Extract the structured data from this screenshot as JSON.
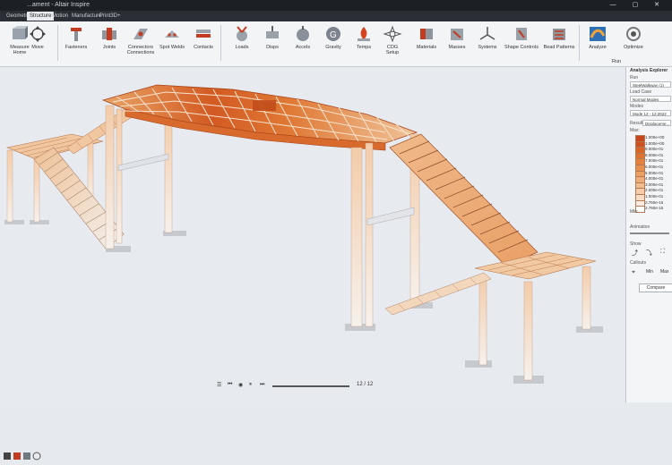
{
  "window": {
    "title": "...ament - Altair Inspire",
    "controls": "— ▢ ✕"
  },
  "tabs": [
    "Geometry",
    "Structure",
    "Motion",
    "Manufacture",
    "Print3D",
    "+"
  ],
  "active_tab": "Structure",
  "ribbon": {
    "items": [
      {
        "label": "Measure\nHome"
      },
      {
        "label": "Move"
      },
      {
        "label": "Fasteners"
      },
      {
        "label": "Joints"
      },
      {
        "label": "Connectors\nConnections"
      },
      {
        "label": "Spot Welds"
      },
      {
        "label": "Contacts"
      },
      {
        "label": "Loads"
      },
      {
        "label": "Disps"
      },
      {
        "label": "Accels"
      },
      {
        "label": "Gravity"
      },
      {
        "label": "Temps"
      },
      {
        "label": "CDG\nSetup"
      },
      {
        "label": "Materials"
      },
      {
        "label": "Masses"
      },
      {
        "label": "Systems"
      },
      {
        "label": "Shape Controls"
      },
      {
        "label": "Bead Patterns"
      },
      {
        "label": "Analyze"
      },
      {
        "label": "Optimize"
      }
    ],
    "run_label": "Run"
  },
  "analysis_explorer": {
    "title": "Analysis Explorer",
    "run_label": "Run",
    "run_value": "SteelWalkway (1)",
    "load_case_label": "Load Case",
    "load_case_value": "Normal Modes",
    "modes_label": "Modes",
    "modes_value": "Mode 12 - 12.2522",
    "result_label": "Result",
    "result_value": "Displaceme...",
    "max_label": "Max:",
    "min_label": "Min:",
    "legend": [
      {
        "value": "1.000e+00",
        "color": "#c8461c"
      },
      {
        "value": "1.000e+00",
        "color": "#d0511f"
      },
      {
        "value": "9.000e-01",
        "color": "#d86426"
      },
      {
        "value": "8.000e-01",
        "color": "#df7330"
      },
      {
        "value": "7.000e-01",
        "color": "#e4823d"
      },
      {
        "value": "6.000e-01",
        "color": "#e8914e"
      },
      {
        "value": "5.000e-01",
        "color": "#eca062"
      },
      {
        "value": "4.000e-01",
        "color": "#efae77"
      },
      {
        "value": "3.000e-01",
        "color": "#f2bd8f"
      },
      {
        "value": "2.000e-01",
        "color": "#f5cca8"
      },
      {
        "value": "1.000e-01",
        "color": "#f8dcc4"
      },
      {
        "value": "2.760e-15",
        "color": "#fbebe0"
      },
      {
        "value": "2.760e-15",
        "color": "#ffffff"
      }
    ],
    "animation_label": "Animation",
    "show_label": "Show",
    "callouts_label": "Callouts",
    "min_max_labels": [
      "Min",
      "Max"
    ],
    "compare_button": "Compare"
  },
  "playback": {
    "frame": "12 / 12"
  }
}
